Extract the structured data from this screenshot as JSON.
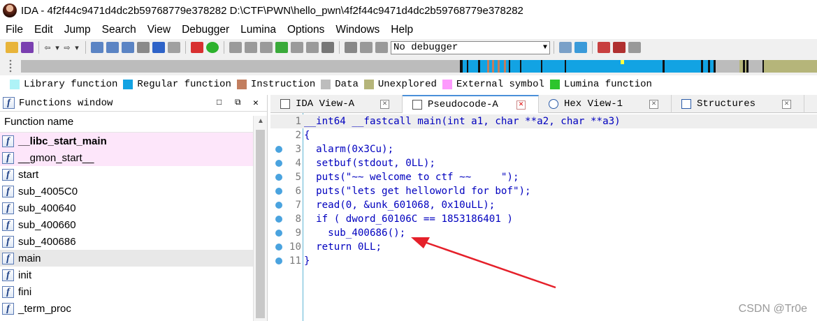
{
  "window": {
    "title": "IDA - 4f2f44c9471d4dc2b59768779e378282 D:\\CTF\\PWN\\hello_pwn\\4f2f44c9471d4dc2b59768779e378282"
  },
  "menu": [
    "File",
    "Edit",
    "Jump",
    "Search",
    "View",
    "Debugger",
    "Lumina",
    "Options",
    "Windows",
    "Help"
  ],
  "toolbar": {
    "debugger_label": "No debugger"
  },
  "legend": [
    {
      "label": "Library function",
      "color": "#aef3f7"
    },
    {
      "label": "Regular function",
      "color": "#12a3e3"
    },
    {
      "label": "Instruction",
      "color": "#c27e5f"
    },
    {
      "label": "Data",
      "color": "#bdbdbd"
    },
    {
      "label": "Unexplored",
      "color": "#b5b57a"
    },
    {
      "label": "External symbol",
      "color": "#fd9afd"
    },
    {
      "label": "Lumina function",
      "color": "#2dc52d"
    }
  ],
  "functions_window": {
    "title": "Functions window",
    "column_header": "Function name",
    "items": [
      {
        "name": "__libc_start_main",
        "kind": "library"
      },
      {
        "name": "__gmon_start__",
        "kind": "library"
      },
      {
        "name": "start",
        "kind": "regular"
      },
      {
        "name": "sub_4005C0",
        "kind": "regular"
      },
      {
        "name": "sub_400640",
        "kind": "regular"
      },
      {
        "name": "sub_400660",
        "kind": "regular"
      },
      {
        "name": "sub_400686",
        "kind": "regular"
      },
      {
        "name": "main",
        "kind": "selected"
      },
      {
        "name": "init",
        "kind": "regular"
      },
      {
        "name": "fini",
        "kind": "regular"
      },
      {
        "name": "_term_proc",
        "kind": "regular"
      }
    ]
  },
  "tabs": [
    {
      "label": "IDA View-A",
      "active": false
    },
    {
      "label": "Pseudocode-A",
      "active": true
    },
    {
      "label": "Hex View-1",
      "active": false
    },
    {
      "label": "Structures",
      "active": false
    }
  ],
  "pseudocode": [
    {
      "num": "1",
      "text": "__int64 __fastcall main(int a1, char **a2, char **a3)",
      "bp": false
    },
    {
      "num": "2",
      "text": "{",
      "bp": false
    },
    {
      "num": "3",
      "text": "  alarm(0x3Cu);",
      "bp": true
    },
    {
      "num": "4",
      "text": "  setbuf(stdout, 0LL);",
      "bp": true
    },
    {
      "num": "5",
      "text": "  puts(\"~~ welcome to ctf ~~     \");",
      "bp": true
    },
    {
      "num": "6",
      "text": "  puts(\"lets get helloworld for bof\");",
      "bp": true
    },
    {
      "num": "7",
      "text": "  read(0, &unk_601068, 0x10uLL);",
      "bp": true
    },
    {
      "num": "8",
      "text": "  if ( dword_60106C == 1853186401 )",
      "bp": true
    },
    {
      "num": "9",
      "text": "    sub_400686();",
      "bp": true
    },
    {
      "num": "10",
      "text": "  return 0LL;",
      "bp": true
    },
    {
      "num": "11",
      "text": "}",
      "bp": true
    }
  ],
  "watermark": "CSDN @Tr0e"
}
